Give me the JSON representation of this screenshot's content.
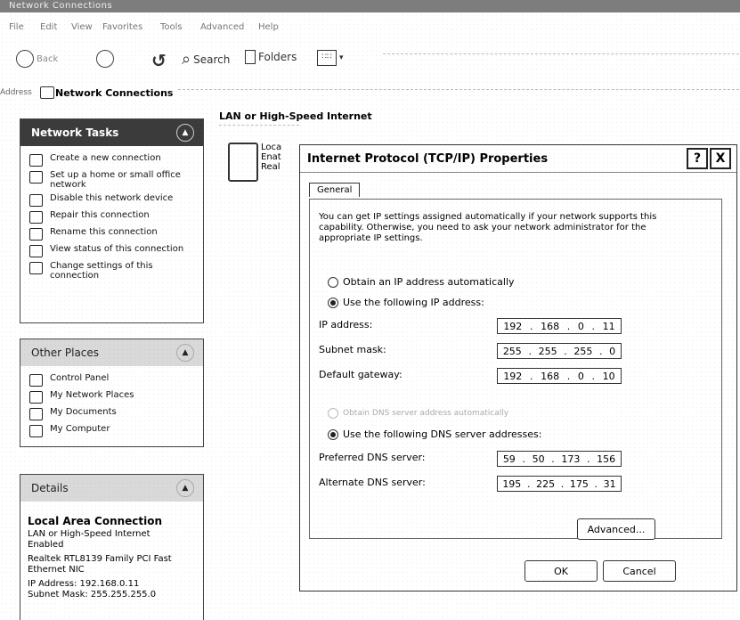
{
  "window": {
    "title": "Network Connections"
  },
  "menu": [
    "File",
    "Edit",
    "View",
    "Favorites",
    "Tools",
    "Advanced",
    "Help"
  ],
  "toolbar": {
    "back_label": "Back",
    "search_label": "Search",
    "folders_label": "Folders"
  },
  "address": {
    "label": "Address",
    "value": "Network Connections"
  },
  "network_tasks": {
    "title": "Network Tasks",
    "items": [
      {
        "label": "Create a new connection"
      },
      {
        "label": "Set up a home or small office network"
      },
      {
        "label": "Disable this network device"
      },
      {
        "label": "Repair this connection"
      },
      {
        "label": "Rename this connection"
      },
      {
        "label": "View status of this connection"
      },
      {
        "label": "Change settings of this connection"
      }
    ]
  },
  "other_places": {
    "title": "Other Places",
    "items": [
      {
        "label": "Control Panel"
      },
      {
        "label": "My Network Places"
      },
      {
        "label": "My Documents"
      },
      {
        "label": "My Computer"
      }
    ]
  },
  "details": {
    "title": "Details",
    "name": "Local Area Connection",
    "type": "LAN or High-Speed Internet",
    "status": "Enabled",
    "adapter": "Realtek RTL8139 Family PCI Fast Ethernet NIC",
    "ip": "IP Address: 192.168.0.11",
    "mask": "Subnet Mask: 255.255.255.0"
  },
  "content": {
    "group_header": "LAN or High-Speed Internet",
    "connection_lines": [
      "Loca",
      "Enat",
      "Real"
    ]
  },
  "dialog": {
    "title": "Internet Protocol (TCP/IP) Properties",
    "help_btn": "?",
    "close_btn": "X",
    "tab": "General",
    "intro": "You can get IP settings assigned automatically if your network supports this capability. Otherwise, you need to ask your network administrator for the appropriate IP settings.",
    "radio_auto_ip": "Obtain an IP address automatically",
    "radio_manual_ip": "Use the following IP address:",
    "ip_label": "IP address:",
    "ip_value": [
      "192",
      "168",
      "0",
      "11"
    ],
    "mask_label": "Subnet mask:",
    "mask_value": [
      "255",
      "255",
      "255",
      "0"
    ],
    "gateway_label": "Default gateway:",
    "gateway_value": [
      "192",
      "168",
      "0",
      "10"
    ],
    "radio_auto_dns": "Obtain DNS server address automatically",
    "radio_manual_dns": "Use the following DNS server addresses:",
    "pref_dns_label": "Preferred DNS server:",
    "pref_dns_value": [
      "59",
      "50",
      "173",
      "156"
    ],
    "alt_dns_label": "Alternate DNS server:",
    "alt_dns_value": [
      "195",
      "225",
      "175",
      "31"
    ],
    "advanced_btn": "Advanced...",
    "ok_btn": "OK",
    "cancel_btn": "Cancel"
  }
}
